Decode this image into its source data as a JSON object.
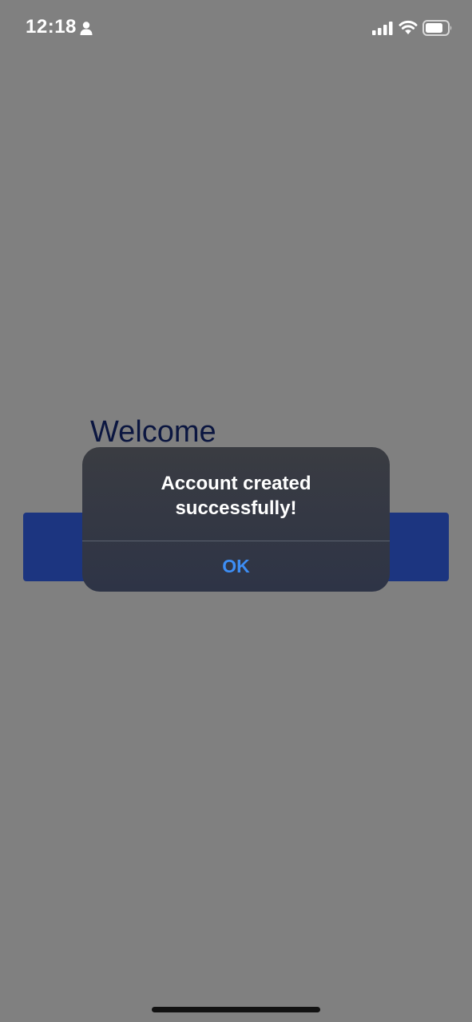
{
  "status_bar": {
    "time": "12:18",
    "icons": [
      "person-icon",
      "signal-icon",
      "wifi-icon",
      "battery-icon"
    ]
  },
  "page": {
    "title": "Welcome"
  },
  "alert": {
    "message": "Account created successfully!",
    "button_label": "OK",
    "button_color": "#3d8ef5"
  },
  "colors": {
    "overlay_background": "#808080",
    "primary_button": "#1c3580",
    "title_text": "#0b1640"
  }
}
